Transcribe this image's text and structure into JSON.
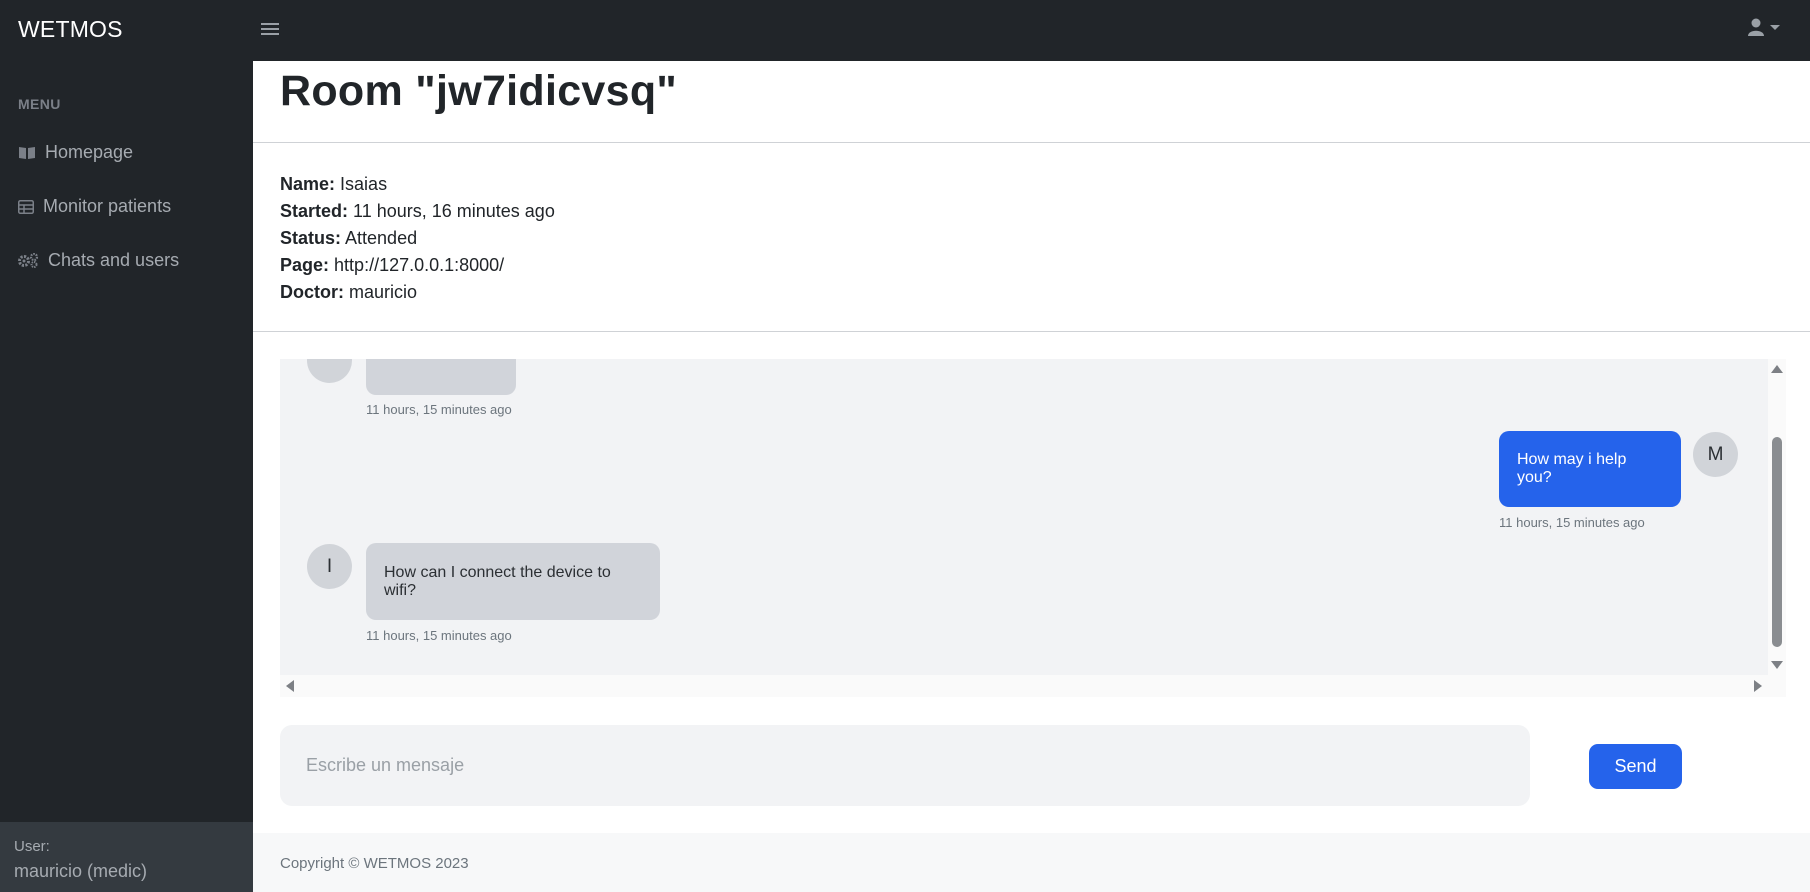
{
  "app": {
    "brand": "WETMOS"
  },
  "header": {
    "menu_icon": "hamburger-icon",
    "user_icon": "user-icon"
  },
  "sidebar": {
    "heading": "MENU",
    "items": [
      {
        "label": "Homepage",
        "icon": "book-open-icon"
      },
      {
        "label": "Monitor patients",
        "icon": "table-icon"
      },
      {
        "label": "Chats and users",
        "icon": "gears-icon"
      }
    ],
    "footer": {
      "label": "User:",
      "value": "mauricio (medic)"
    }
  },
  "room": {
    "title": "Room \"jw7idicvsq\"",
    "fields": [
      {
        "label": "Name:",
        "value": "Isaias"
      },
      {
        "label": "Started:",
        "value": "11 hours, 16 minutes ago"
      },
      {
        "label": "Status:",
        "value": "Attended"
      },
      {
        "label": "Page:",
        "value": "http://127.0.0.1:8000/"
      },
      {
        "label": "Doctor:",
        "value": "mauricio"
      }
    ]
  },
  "chat": {
    "messages": [
      {
        "side": "in",
        "avatar": "",
        "text": "",
        "time": "11 hours, 15 minutes ago"
      },
      {
        "side": "out",
        "avatar": "M",
        "text": "How may i help you?",
        "time": "11 hours, 15 minutes ago"
      },
      {
        "side": "in",
        "avatar": "I",
        "text": "How can I connect the device to wifi?",
        "time": "11 hours, 15 minutes ago"
      }
    ],
    "input_placeholder": "Escribe un mensaje",
    "send_label": "Send"
  },
  "footer": {
    "copyright": "Copyright © WETMOS 2023"
  },
  "colors": {
    "sidebar": "#212529",
    "accent": "#2563eb",
    "bubble_in": "#d1d4da",
    "chat_bg": "#f2f3f5"
  }
}
